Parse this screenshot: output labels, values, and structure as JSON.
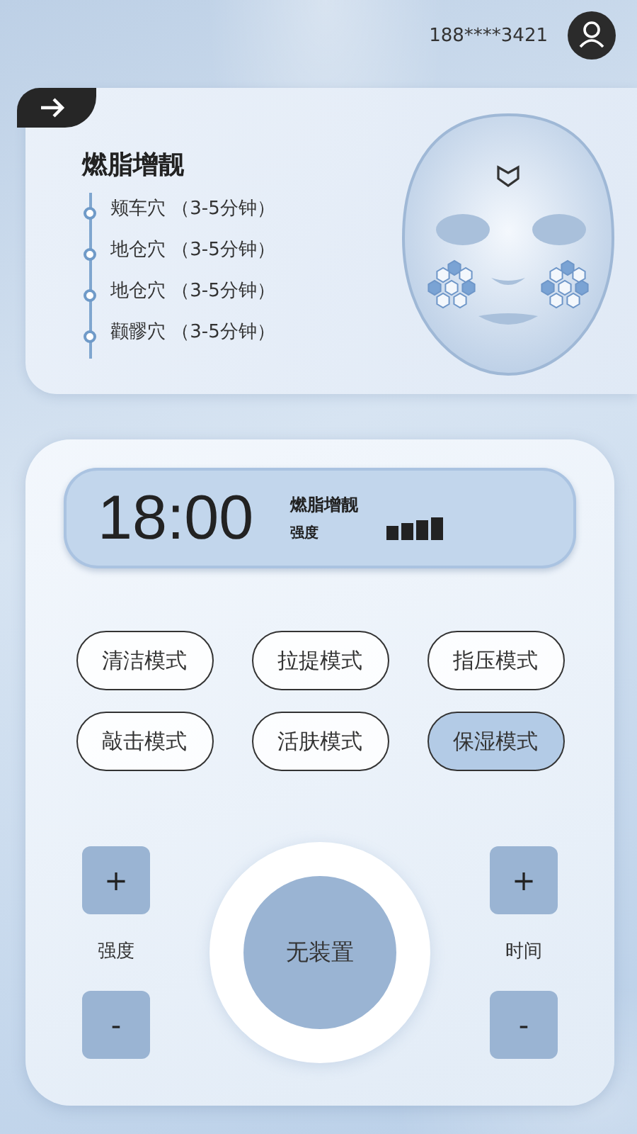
{
  "header": {
    "phone": "188****3421"
  },
  "program": {
    "title": "燃脂增靓",
    "points": [
      {
        "text": "颊车穴 （3-5分钟）"
      },
      {
        "text": "地仓穴 （3-5分钟）"
      },
      {
        "text": "地仓穴 （3-5分钟）"
      },
      {
        "text": "颧髎穴 （3-5分钟）"
      }
    ]
  },
  "display": {
    "time": "18:00",
    "mode": "燃脂增靓",
    "intensity_label": "强度"
  },
  "modes": [
    {
      "label": "清洁模式",
      "selected": false
    },
    {
      "label": "拉提模式",
      "selected": false
    },
    {
      "label": "指压模式",
      "selected": false
    },
    {
      "label": "敲击模式",
      "selected": false
    },
    {
      "label": "活肤模式",
      "selected": false
    },
    {
      "label": "保湿模式",
      "selected": true
    }
  ],
  "controls": {
    "intensity": {
      "plus": "+",
      "label": "强度",
      "minus": "-"
    },
    "device": "无装置",
    "time": {
      "plus": "+",
      "label": "时间",
      "minus": "-"
    }
  }
}
